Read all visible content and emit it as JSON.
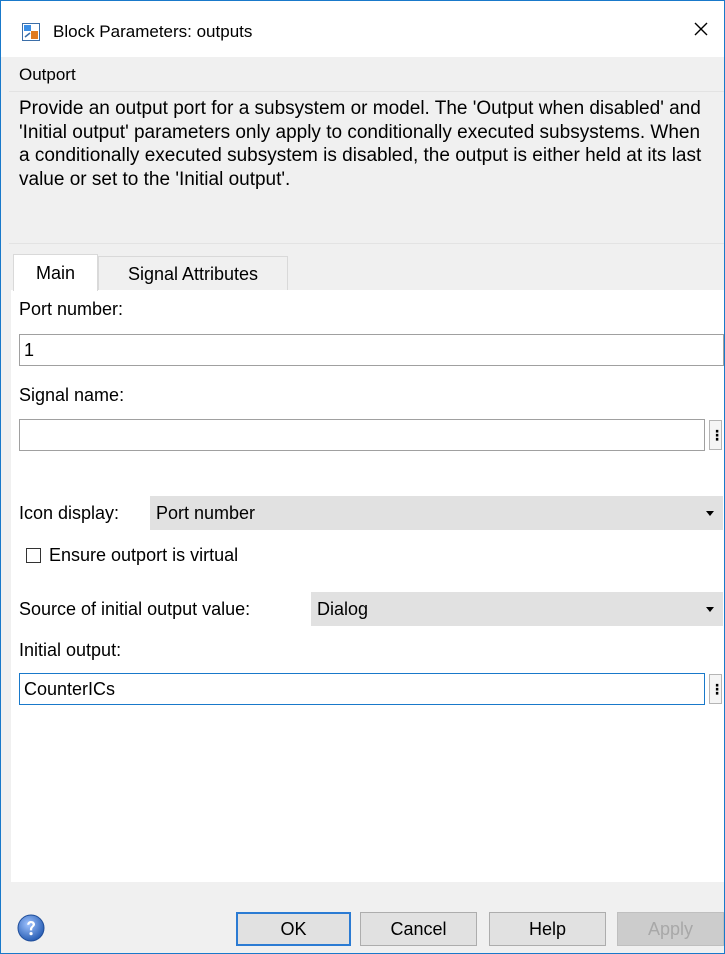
{
  "window": {
    "title": "Block Parameters: outputs",
    "close_glyph": "✕"
  },
  "block": {
    "type_title": "Outport",
    "description": "Provide an output port for a subsystem or model.  The 'Output when disabled' and 'Initial output' parameters only apply to conditionally executed subsystems. When a conditionally executed subsystem is disabled, the output is either held at its last value or set to the 'Initial output'."
  },
  "tabs": [
    {
      "label": "Main",
      "active": true
    },
    {
      "label": "Signal Attributes",
      "active": false
    }
  ],
  "main": {
    "port_number": {
      "label": "Port number:",
      "value": "1"
    },
    "signal_name": {
      "label": "Signal name:",
      "value": "",
      "more_glyph": "⋮"
    },
    "icon_display": {
      "label": "Icon display:",
      "selected": "Port number"
    },
    "ensure_virtual": {
      "label": "Ensure outport is virtual",
      "checked": false
    },
    "source_initial": {
      "label": "Source of initial output value:",
      "selected": "Dialog"
    },
    "initial_output": {
      "label": "Initial output:",
      "value": "CounterICs",
      "more_glyph": "⋮"
    }
  },
  "buttons": {
    "ok": "OK",
    "cancel": "Cancel",
    "help": "Help",
    "apply": "Apply"
  },
  "icons": {
    "app": "simulink-block-icon",
    "help": "help-question-icon",
    "close": "close-icon"
  },
  "colors": {
    "accent": "#1979ca",
    "window_bg": "#f0f0f0",
    "panel_bg": "#ffffff",
    "button_bg": "#e1e1e1",
    "disabled_text": "#a8a8a8"
  }
}
